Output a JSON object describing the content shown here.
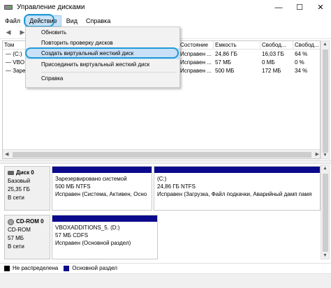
{
  "window": {
    "title": "Управление дисками",
    "controls": {
      "minimize": "—",
      "maximize": "☐",
      "close": "✕"
    }
  },
  "menu": {
    "items": [
      "Файл",
      "Действие",
      "Вид",
      "Справка"
    ]
  },
  "toolbar": {
    "back": "◀",
    "forward": "▶"
  },
  "volume_list": {
    "columns": [
      "Том",
      "Состояние",
      "Емкость",
      "Свобод...",
      "Свобод..."
    ],
    "rows": [
      {
        "tom": "(C:)",
        "state": "Исправен ...",
        "capacity": "24,86 ГБ",
        "free": "16,03 ГБ",
        "free_pct": "64 %"
      },
      {
        "tom": "VBO",
        "state": "Исправен ...",
        "capacity": "57 МБ",
        "free": "0 МБ",
        "free_pct": "0 %"
      },
      {
        "tom": "Заре",
        "state": "Исправен ...",
        "capacity": "500 МБ",
        "free": "172 МБ",
        "free_pct": "34 %"
      }
    ]
  },
  "dropdown": {
    "items": [
      "Обновить",
      "Повторить проверку дисков",
      "Создать виртуальный жесткий диск",
      "Присоединить виртуальный жесткий диск",
      "Справка"
    ],
    "selected_index": 2
  },
  "disks": [
    {
      "name": "Диск 0",
      "type": "Базовый",
      "size": "25,35 ГБ",
      "status": "В сети",
      "partitions": [
        {
          "name": "Зарезервировано системой",
          "size": "500 МБ NTFS",
          "status": "Исправен (Система, Активен, Осно"
        },
        {
          "name": "(C:)",
          "size": "24,86 ГБ NTFS",
          "status": "Исправен (Загрузка, Файл подкачки, Аварийный дамп памя"
        }
      ]
    },
    {
      "name": "CD-ROM 0",
      "type": "CD-ROM",
      "size": "57 МБ",
      "status": "В сети",
      "partitions": [
        {
          "name": "VBOXADDITIONS_5.  (D:)",
          "size": "57 МБ CDFS",
          "status": "Исправен (Основной раздел)"
        }
      ]
    }
  ],
  "legend": {
    "items": [
      {
        "label": "Не распределена",
        "color": "#000000"
      },
      {
        "label": "Основной раздел",
        "color": "#0b0a8c"
      }
    ]
  }
}
